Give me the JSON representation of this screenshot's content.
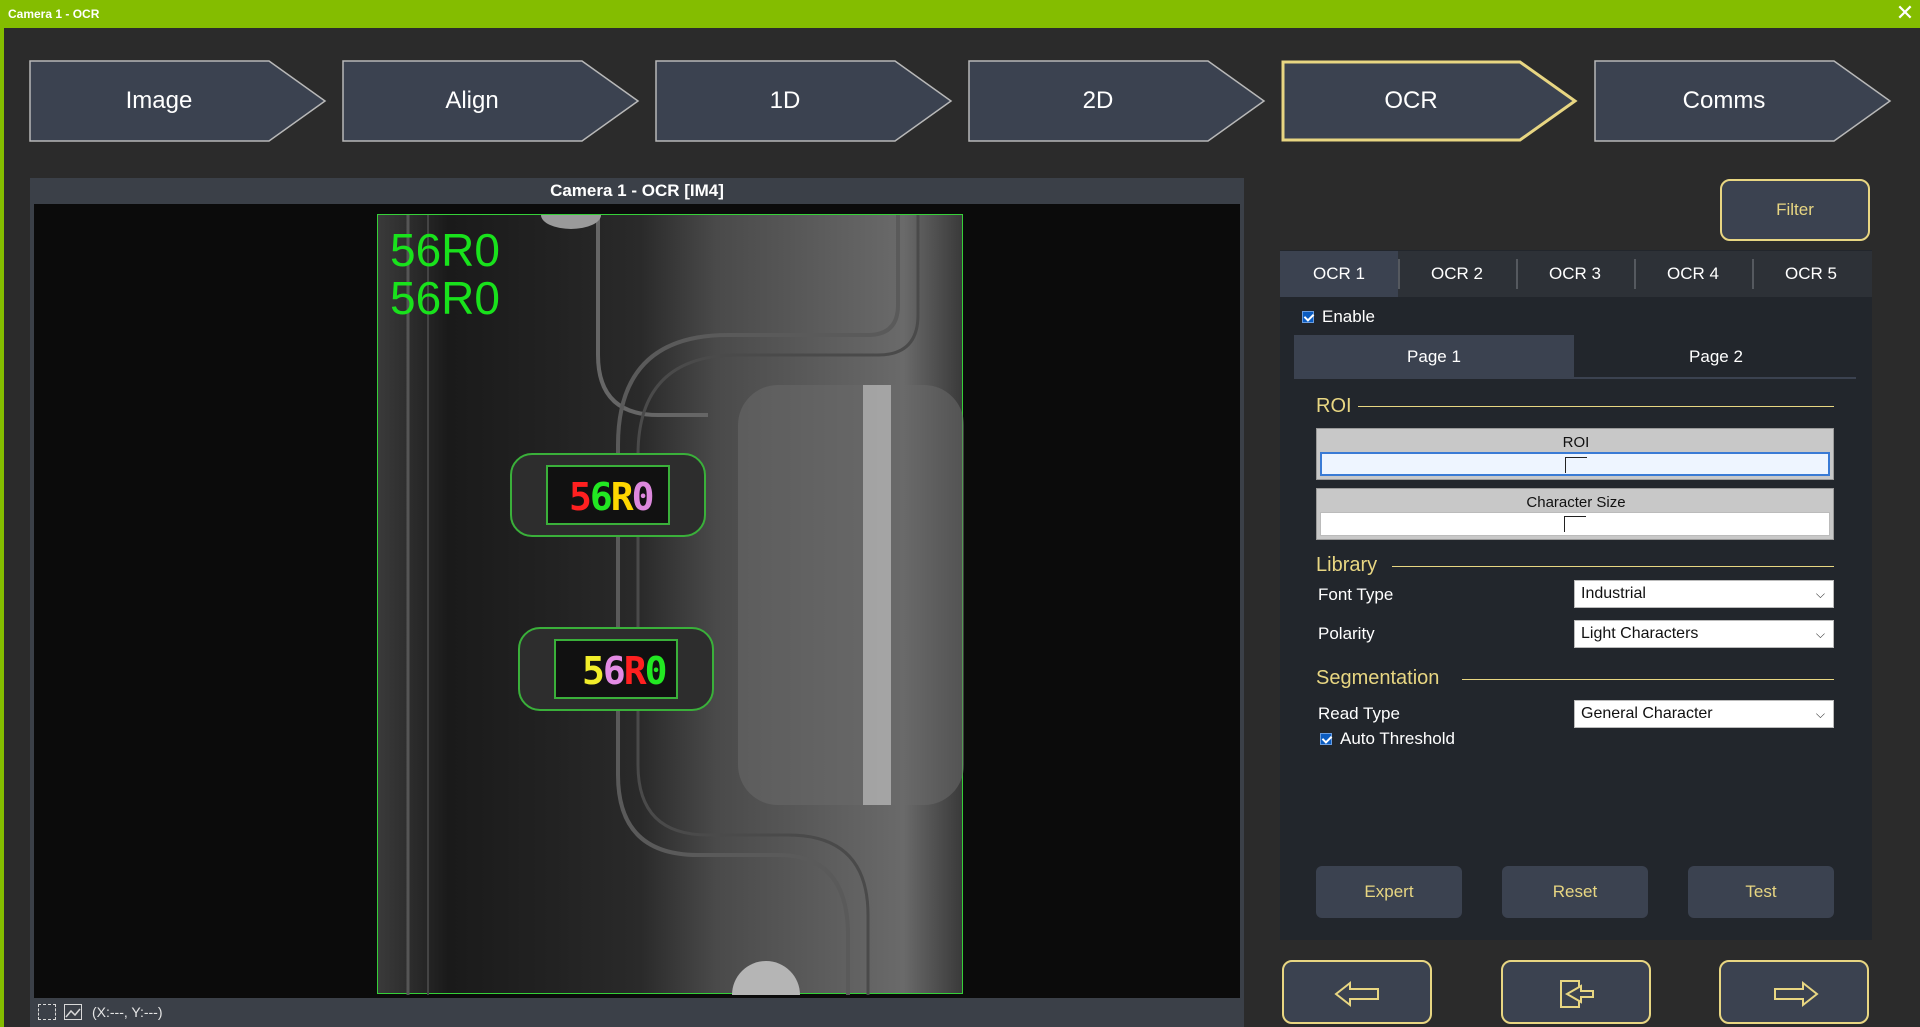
{
  "window": {
    "title": "Camera 1 - OCR",
    "close_icon": "close-icon"
  },
  "steps": [
    {
      "label": "Image",
      "active": false
    },
    {
      "label": "Align",
      "active": false
    },
    {
      "label": "1D",
      "active": false
    },
    {
      "label": "2D",
      "active": false
    },
    {
      "label": "OCR",
      "active": true
    },
    {
      "label": "Comms",
      "active": false
    }
  ],
  "viewer": {
    "title": "Camera 1 - OCR  [IM4]",
    "ocr_results": [
      "56R0",
      "56R0"
    ],
    "chip_marks": [
      {
        "chars": [
          "5",
          "6",
          "R",
          "0"
        ],
        "colors": [
          "#ff2020",
          "#22e822",
          "#ffd700",
          "#dd88dd"
        ]
      },
      {
        "chars": [
          "5",
          "6",
          "R",
          "0"
        ],
        "colors": [
          "#f2ee2a",
          "#e48be4",
          "#ff2020",
          "#22e822"
        ]
      }
    ],
    "coords": "(X:---, Y:---)",
    "status_icons": [
      "fit-view-icon",
      "image-icon"
    ]
  },
  "right": {
    "filter_label": "Filter",
    "ocr_tabs": [
      "OCR 1",
      "OCR 2",
      "OCR 3",
      "OCR 4",
      "OCR 5"
    ],
    "active_ocr_tab": "OCR 1",
    "enable_label": "Enable",
    "enable_checked": true,
    "page_tabs": [
      "Page 1",
      "Page 2"
    ],
    "active_page_tab": "Page 1",
    "roi_section": "ROI",
    "roi_label": "ROI",
    "char_size_label": "Character Size",
    "library_section": "Library",
    "font_type_label": "Font Type",
    "font_type_value": "Industrial",
    "polarity_label": "Polarity",
    "polarity_value": "Light Characters",
    "segmentation_section": "Segmentation",
    "read_type_label": "Read Type",
    "read_type_value": "General Character",
    "auto_threshold_label": "Auto Threshold",
    "auto_threshold_checked": true,
    "buttons": {
      "expert": "Expert",
      "reset": "Reset",
      "test": "Test"
    },
    "nav_icons": [
      "arrow-left-icon",
      "exit-door-icon",
      "arrow-right-icon"
    ]
  },
  "colors": {
    "accent": "#84bd00",
    "gold": "#e8d682",
    "button_bg": "#3b4250",
    "ocr_green": "#19e21c"
  }
}
